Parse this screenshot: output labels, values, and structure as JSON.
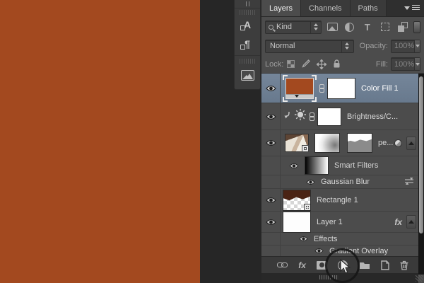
{
  "canvas": {
    "fill_color": "#a3491f"
  },
  "dock": {
    "icons": [
      {
        "name": "character-styles",
        "glyph": "A"
      },
      {
        "name": "paragraph-styles",
        "glyph": "¶"
      },
      {
        "name": "image-panel"
      }
    ]
  },
  "layers_panel": {
    "tabs": [
      {
        "label": "Layers",
        "active": true
      },
      {
        "label": "Channels",
        "active": false
      },
      {
        "label": "Paths",
        "active": false
      }
    ],
    "filter_bar": {
      "search_label": "Kind",
      "type_glyph": "T",
      "type_icons": [
        "pixel-layers",
        "adjustment-layers",
        "type-layers",
        "shape-layers",
        "smart-objects"
      ]
    },
    "blend_bar": {
      "blend_mode": "Normal",
      "opacity_label": "Opacity:",
      "opacity_value": "100%"
    },
    "lock_bar": {
      "label": "Lock:",
      "fill_label": "Fill:",
      "fill_value": "100%",
      "lock_icons": [
        "lock-transparency",
        "lock-image",
        "lock-position",
        "lock-all"
      ]
    },
    "layers": [
      {
        "name": "Color Fill 1",
        "kind": "solid-color-fill",
        "selected": true,
        "visible": true
      },
      {
        "name": "Brightness/C...",
        "kind": "brightness-contrast-adjustment",
        "clipped": true,
        "visible": true
      },
      {
        "name": "pe...",
        "kind": "smart-object",
        "visible": true,
        "expanded": true
      },
      {
        "name": "Smart Filters",
        "kind": "smart-filters-group",
        "visible": true
      },
      {
        "name": "Gaussian Blur",
        "kind": "smart-filter",
        "visible": true
      },
      {
        "name": "Rectangle 1",
        "kind": "shape",
        "visible": true
      },
      {
        "name": "Layer 1",
        "kind": "raster",
        "visible": true,
        "has_effects": true
      },
      {
        "name": "Effects",
        "kind": "effects-group",
        "visible": true
      },
      {
        "name": "Gradient Overlay",
        "kind": "layer-effect",
        "visible": true
      }
    ],
    "fx_badge": "fx",
    "footer_icons": [
      "link-layers",
      "add-layer-style",
      "add-layer-mask",
      "new-adjustment-layer",
      "new-group",
      "new-layer",
      "delete-layer"
    ]
  },
  "annotation": {
    "highlighted_icon": "new-adjustment-layer"
  },
  "colors": {
    "selected_row": "#6f8195",
    "panel_bg": "#4c4c4c",
    "canvas": "#a3491f"
  }
}
